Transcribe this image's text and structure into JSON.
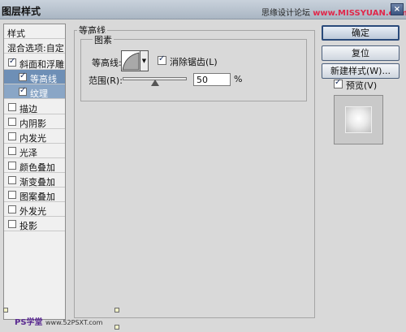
{
  "window": {
    "title": "图层样式",
    "close_icon": "×",
    "watermark": "思缘设计论坛",
    "watermark_site": "www.MISSYUAN.com"
  },
  "sidebar": {
    "header": "样式",
    "blend_options": "混合选项:自定",
    "items": [
      {
        "label": "斜面和浮雕",
        "checked": true
      },
      {
        "label": "等高线",
        "checked": true
      },
      {
        "label": "纹理",
        "checked": true
      },
      {
        "label": "描边",
        "checked": false
      },
      {
        "label": "内阴影",
        "checked": false
      },
      {
        "label": "内发光",
        "checked": false
      },
      {
        "label": "光泽",
        "checked": false
      },
      {
        "label": "颜色叠加",
        "checked": false
      },
      {
        "label": "渐变叠加",
        "checked": false
      },
      {
        "label": "图案叠加",
        "checked": false
      },
      {
        "label": "外发光",
        "checked": false
      },
      {
        "label": "投影",
        "checked": false
      }
    ]
  },
  "panel": {
    "section_title": "等高线",
    "group_title": "图素",
    "contour_label": "等高线:",
    "antialias_label": "消除锯齿(L)",
    "antialias_checked": true,
    "range_label": "范围(R):",
    "range_value": "50",
    "range_unit": "%"
  },
  "buttons": {
    "ok": "确定",
    "reset": "复位",
    "new_style": "新建样式(W)..."
  },
  "preview": {
    "label": "预览(V)",
    "checked": true
  },
  "footer": {
    "watermark": "PS学堂",
    "site": "www.52PSXT.com"
  }
}
